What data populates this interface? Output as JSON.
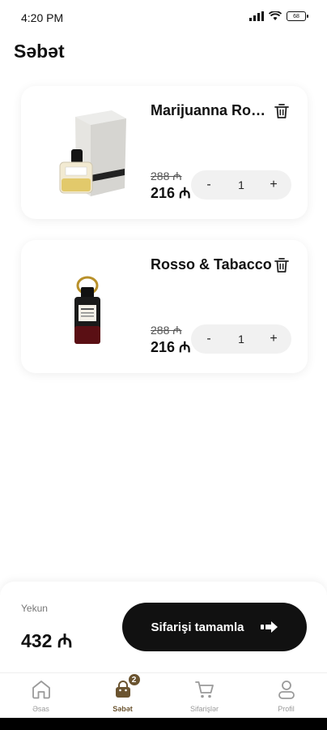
{
  "status_bar": {
    "time": "4:20 PM",
    "battery": "68"
  },
  "header": {
    "title": "Səbət"
  },
  "cart": {
    "items": [
      {
        "name": "Marijuanna Rosso",
        "old_price": "288 ₼",
        "price": "216 ₼",
        "quantity": "1",
        "minus": "-",
        "plus": "+"
      },
      {
        "name": "Rosso & Tabacco",
        "old_price": "288 ₼",
        "price": "216 ₼",
        "quantity": "1",
        "minus": "-",
        "plus": "+"
      }
    ]
  },
  "checkout": {
    "total_label": "Yekun",
    "total_value": "432 ₼",
    "button_label": "Sifarişi tamamla"
  },
  "nav": {
    "items": [
      {
        "label": "Əsas",
        "icon": "home-icon"
      },
      {
        "label": "Səbət",
        "icon": "cart-bag-icon",
        "badge": "2"
      },
      {
        "label": "Sifarişlər",
        "icon": "shopping-cart-icon"
      },
      {
        "label": "Profil",
        "icon": "user-icon"
      }
    ]
  },
  "colors": {
    "accent": "#6b5430",
    "button_dark": "#111111"
  }
}
